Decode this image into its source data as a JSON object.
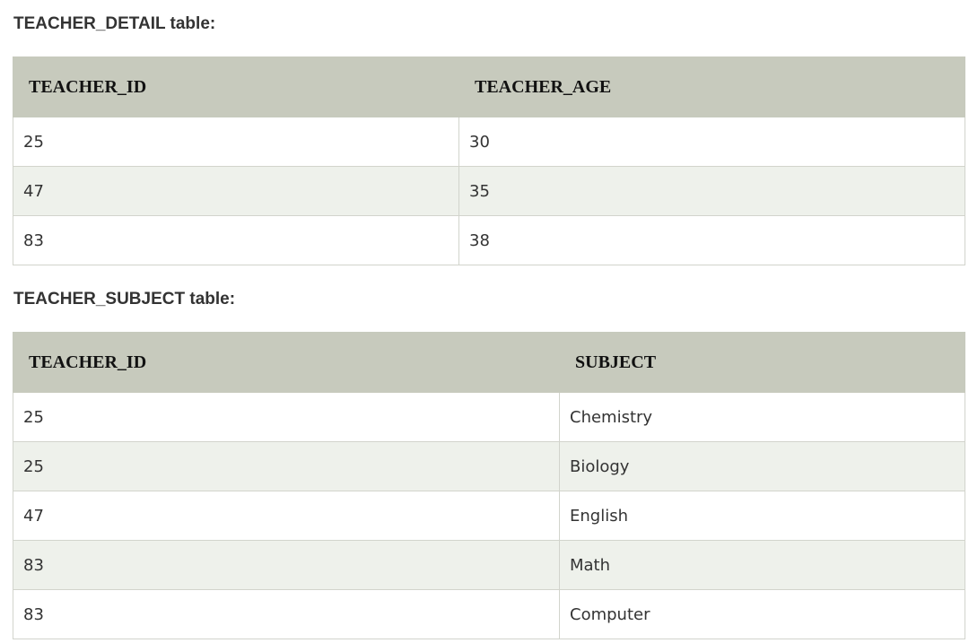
{
  "tables": [
    {
      "caption": "TEACHER_DETAIL table:",
      "headers": [
        "TEACHER_ID",
        "TEACHER_AGE"
      ],
      "rows": [
        [
          "25",
          "30"
        ],
        [
          "47",
          "35"
        ],
        [
          "83",
          "38"
        ]
      ]
    },
    {
      "caption": "TEACHER_SUBJECT table:",
      "headers": [
        "TEACHER_ID",
        "SUBJECT"
      ],
      "rows": [
        [
          "25",
          "Chemistry"
        ],
        [
          "25",
          "Biology"
        ],
        [
          "47",
          "English"
        ],
        [
          "83",
          "Math"
        ],
        [
          "83",
          "Computer"
        ]
      ]
    }
  ],
  "colors": {
    "header_bg": "#c7cabd",
    "row_alt_bg": "#eef1eb",
    "row_bg": "#ffffff",
    "border": "#d2d4cc"
  }
}
